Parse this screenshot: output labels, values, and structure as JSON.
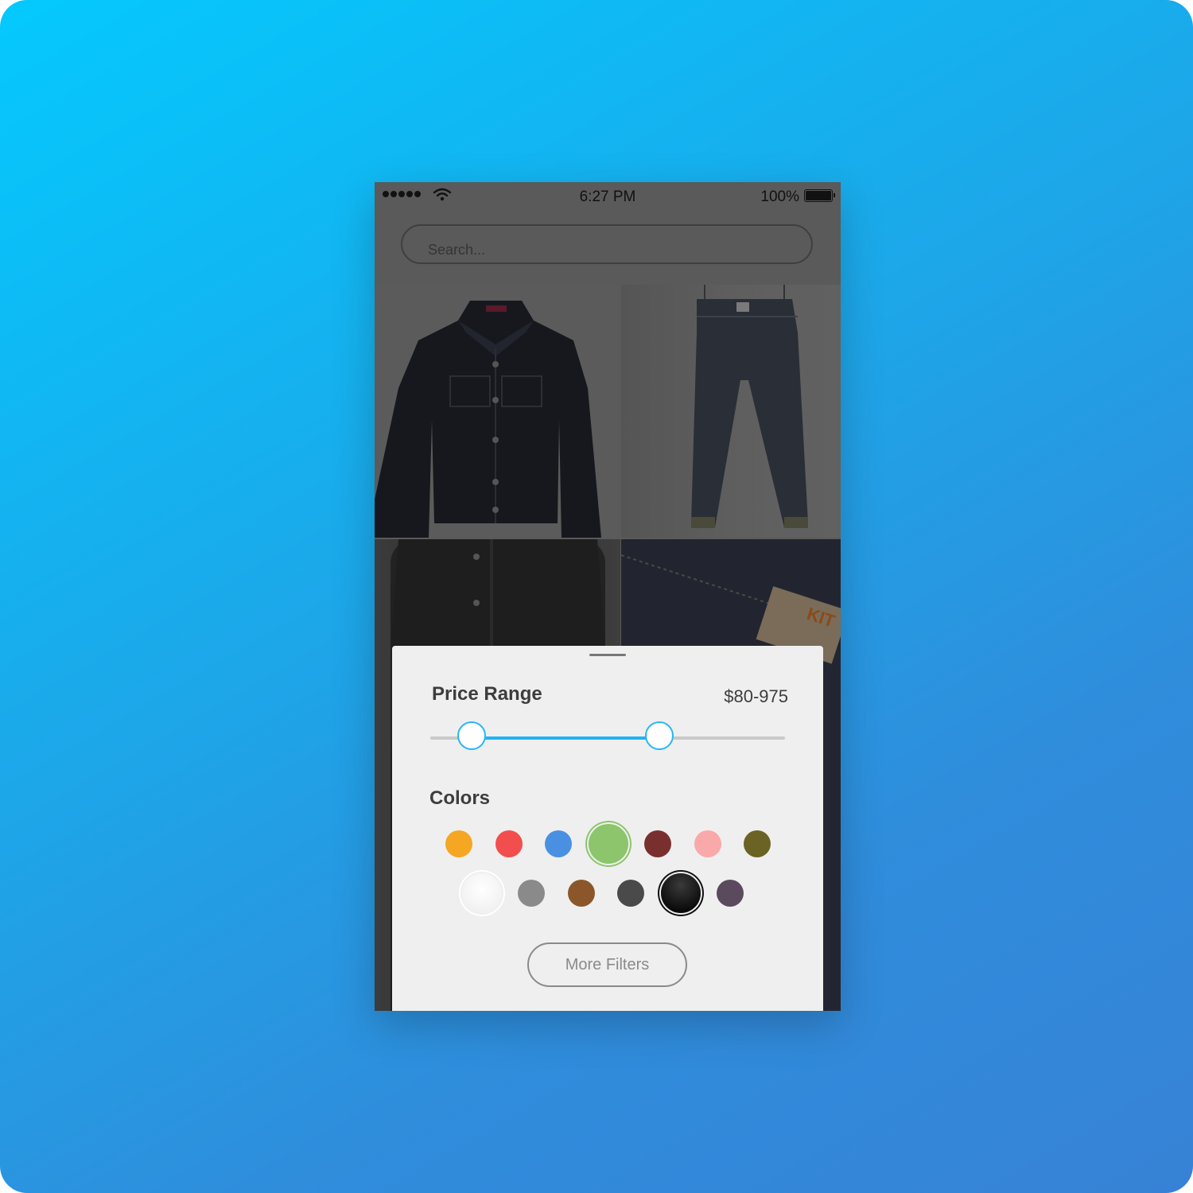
{
  "status_bar": {
    "time": "6:27 PM",
    "battery_percent": "100%",
    "signal_bars": 5
  },
  "search": {
    "placeholder": "Search..."
  },
  "products": [
    {
      "name": "denim-jacket-photo"
    },
    {
      "name": "hanging-jeans-photo"
    },
    {
      "name": "model-denim-photo"
    },
    {
      "name": "jeans-label-photo"
    }
  ],
  "filter_sheet": {
    "price_range": {
      "title": "Price Range",
      "value_text": "$80-975",
      "low_fraction": 0.116,
      "high_fraction": 0.646
    },
    "colors": {
      "title": "Colors",
      "row1": [
        {
          "name": "orange",
          "hex": "#f5a623",
          "selected": false
        },
        {
          "name": "red",
          "hex": "#f24e4e",
          "selected": false
        },
        {
          "name": "blue",
          "hex": "#4a90e2",
          "selected": false
        },
        {
          "name": "green",
          "hex": "#8cc56b",
          "selected": true
        },
        {
          "name": "maroon",
          "hex": "#7a2f2f",
          "selected": false
        },
        {
          "name": "pink",
          "hex": "#f9a9a9",
          "selected": false
        },
        {
          "name": "olive",
          "hex": "#6b6323",
          "selected": false
        }
      ],
      "row2": [
        {
          "name": "white",
          "hex": "#f4f4f4",
          "selected": true
        },
        {
          "name": "gray",
          "hex": "#8a8a8a",
          "selected": false
        },
        {
          "name": "brown",
          "hex": "#8b572a",
          "selected": false
        },
        {
          "name": "dark-gray",
          "hex": "#4a4a4a",
          "selected": false
        },
        {
          "name": "black",
          "hex": "#111111",
          "selected": true
        },
        {
          "name": "plum",
          "hex": "#5b4a5e",
          "selected": false
        }
      ]
    },
    "more_filters_label": "More Filters"
  },
  "theme": {
    "accent": "#22b2f4",
    "overlay": "#5a5a5a"
  }
}
